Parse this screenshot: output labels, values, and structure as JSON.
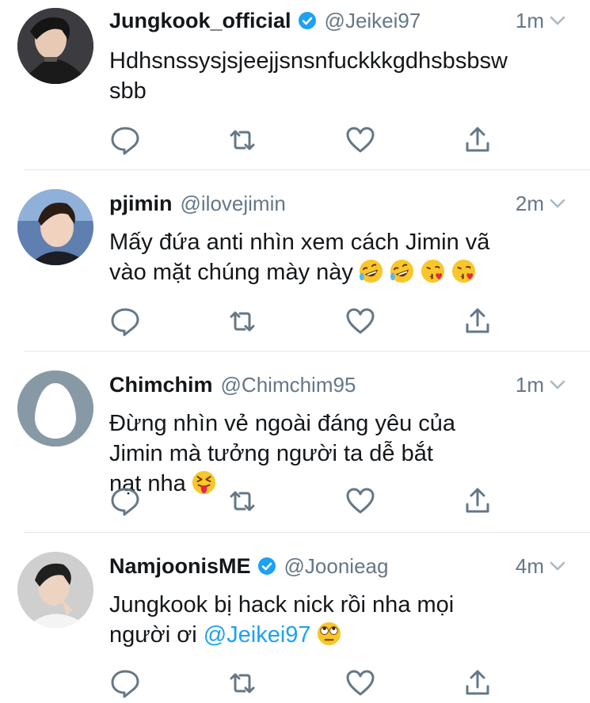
{
  "tweets": [
    {
      "display_name": "Jungkook_official",
      "verified": true,
      "handle": "@Jeikei97",
      "time": "1m",
      "text": "Hdhsnssysjsjeejjsnsnfuckkkgdhsbsbsw\nsbb",
      "emojis": []
    },
    {
      "display_name": "pjimin",
      "verified": false,
      "handle": "@ilovejimin",
      "time": "2m",
      "text": "Mấy đứa anti nhìn xem cách Jimin vã\nvào mặt chúng mày này",
      "emojis": [
        "rofl-emoji",
        "rofl-emoji",
        "kissing-heart-emoji",
        "kissing-heart-emoji"
      ]
    },
    {
      "display_name": "Chimchim",
      "verified": false,
      "handle": "@Chimchim95",
      "time": "1m",
      "text": "Đừng nhìn vẻ ngoài đáng yêu của\nJimin mà tưởng người ta dễ bắt\nnạt nha",
      "emojis": [
        "squinting-tongue-emoji"
      ]
    },
    {
      "display_name": "NamjoonisME",
      "verified": true,
      "handle": "@Joonieag",
      "time": "4m",
      "text_before": "Jungkook bị hack nick rồi nha mọi\nngười ơi ",
      "mention": "@Jeikei97",
      "emojis": [
        "eye-roll-emoji"
      ]
    }
  ],
  "icons": {
    "reply": "reply-icon",
    "retweet": "retweet-icon",
    "like": "heart-icon",
    "share": "share-icon",
    "caret": "chevron-down-icon",
    "verified": "verified-badge-icon",
    "default_avatar": "egg-avatar-icon"
  },
  "colors": {
    "accent": "#1da1f2",
    "secondary_text": "#657786",
    "icon_gray": "#657786",
    "divider": "#e1e8ed",
    "default_avatar_bg": "#8899a6"
  }
}
